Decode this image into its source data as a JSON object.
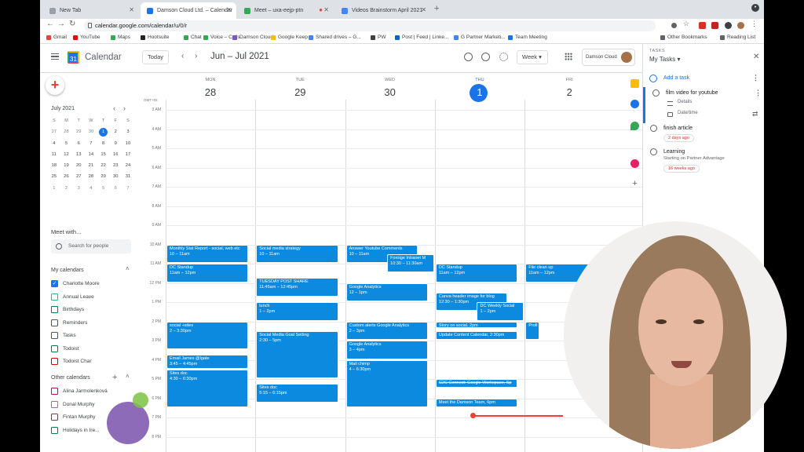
{
  "browser": {
    "tabs": [
      {
        "title": "New Tab",
        "fav": "#9aa0a6"
      },
      {
        "title": "Damson Cloud Ltd. – Calendar",
        "fav": "#1a73e8"
      },
      {
        "title": "Meet – uxa-eejp-ptn",
        "fav": "#34a853"
      },
      {
        "title": "Videos Brainstorm April 2021",
        "fav": "#4285f4"
      }
    ],
    "url": "calendar.google.com/calendar/u/0/r",
    "bookmarks": [
      "Gmail",
      "YouTube",
      "Maps",
      "Hootsuite",
      "Chat",
      "Voice – Calls",
      "Damson Cloud",
      "Google Keep",
      "Shared drives – G...",
      "PW",
      "Post | Feed | Linke...",
      "G Partner Marketi...",
      "Team Meeting"
    ],
    "bookmark_colors": [
      "#ea4335",
      "#ff0000",
      "#34a853",
      "#222222",
      "#34a853",
      "#34a853",
      "#7e57c2",
      "#fbbc04",
      "#4285f4",
      "#3c4043",
      "#0a66c2",
      "#4285f4",
      "#1a73e8"
    ],
    "other_bookmarks": "Other Bookmarks",
    "reading_list": "Reading List"
  },
  "header": {
    "app_name": "Calendar",
    "today_label": "Today",
    "date_range": "Jun – Jul 2021",
    "view": "Week",
    "account": "Damson Cloud"
  },
  "sidebar": {
    "create_icon": "plus-icon",
    "mini_title": "July 2021",
    "mini_days": [
      "S",
      "M",
      "T",
      "W",
      "T",
      "F",
      "S"
    ],
    "mini_weeks": [
      [
        "27",
        "28",
        "29",
        "30",
        "1",
        "2",
        "3"
      ],
      [
        "4",
        "5",
        "6",
        "7",
        "8",
        "9",
        "10"
      ],
      [
        "11",
        "12",
        "13",
        "14",
        "15",
        "16",
        "17"
      ],
      [
        "18",
        "19",
        "20",
        "21",
        "22",
        "23",
        "24"
      ],
      [
        "25",
        "26",
        "27",
        "28",
        "29",
        "30",
        "31"
      ],
      [
        "1",
        "2",
        "3",
        "4",
        "5",
        "6",
        "7"
      ]
    ],
    "meet_title": "Meet with...",
    "search_people": "Search for people",
    "my_calendars_title": "My calendars",
    "my_calendars": [
      {
        "name": "Charlotte Moore",
        "color": "#1a73e8",
        "checked": true
      },
      {
        "name": "Annual Leave",
        "color": "#33b679",
        "checked": false
      },
      {
        "name": "Birthdays",
        "color": "#0b8043",
        "checked": false
      },
      {
        "name": "Reminders",
        "color": "#3f51b5",
        "checked": false
      },
      {
        "name": "Tasks",
        "color": "#3f51b5",
        "checked": false
      },
      {
        "name": "Todoist",
        "color": "#0b8043",
        "checked": false
      },
      {
        "name": "Todoist Char",
        "color": "#d50000",
        "checked": false
      }
    ],
    "other_calendars_title": "Other calendars",
    "other_calendars": [
      {
        "name": "Alina Jarmolenková",
        "color": "#ad1457",
        "checked": false
      },
      {
        "name": "Donal Murphy",
        "color": "#9e69af",
        "checked": false
      },
      {
        "name": "Fintan Murphy",
        "color": "#8e24aa",
        "checked": false
      },
      {
        "name": "Holidays in Ire...",
        "color": "#0b8043",
        "checked": false
      }
    ]
  },
  "week": {
    "timezone": "GMT+02",
    "days": [
      {
        "dow": "MON",
        "num": "28"
      },
      {
        "dow": "TUE",
        "num": "29"
      },
      {
        "dow": "WED",
        "num": "30"
      },
      {
        "dow": "THU",
        "num": "1",
        "current": true
      },
      {
        "dow": "FRI",
        "num": "2"
      }
    ],
    "hours": [
      "3 AM",
      "4 AM",
      "5 AM",
      "6 AM",
      "7 AM",
      "8 AM",
      "9 AM",
      "10 AM",
      "11 AM",
      "12 PM",
      "1 PM",
      "2 PM",
      "3 PM",
      "4 PM",
      "5 PM",
      "6 PM",
      "7 PM",
      "8 PM"
    ],
    "events": [
      {
        "day": 0,
        "start": 10,
        "end": 11,
        "title": "Monthly Stat Report - social, web etc",
        "time": "10 – 11am"
      },
      {
        "day": 0,
        "start": 11,
        "end": 12,
        "title": "DC Standup",
        "time": "11am – 12pm"
      },
      {
        "day": 0,
        "start": 14,
        "end": 15.5,
        "title": "social +sites",
        "time": "2 – 3:30pm"
      },
      {
        "day": 0,
        "start": 15.75,
        "end": 16.5,
        "title": "Email James @lgate",
        "time": "3:45 – 4:45pm"
      },
      {
        "day": 0,
        "start": 16.5,
        "end": 18.5,
        "title": "Sites doc",
        "time": "4:30 – 6:30pm",
        "indent": true
      },
      {
        "day": 1,
        "start": 10,
        "end": 11,
        "title": "Social  media strategy",
        "time": "10 – 11am"
      },
      {
        "day": 1,
        "start": 11.75,
        "end": 12.75,
        "title": "TUESDAY POST SHARE",
        "time": "11:45am – 12:45pm"
      },
      {
        "day": 1,
        "start": 13,
        "end": 14,
        "title": "lunch",
        "time": "1 – 2pm"
      },
      {
        "day": 1,
        "start": 14.5,
        "end": 17,
        "title": "Social Media Goal Setting",
        "time": "2:30 – 5pm"
      },
      {
        "day": 1,
        "start": 17.25,
        "end": 18.25,
        "title": "Sites doc",
        "time": "5:15 – 6:15pm"
      },
      {
        "day": 2,
        "start": 10,
        "end": 11,
        "title": "Answer Youtube Comments",
        "time": "10 – 11am",
        "narrow": true
      },
      {
        "day": 2,
        "start": 10.5,
        "end": 11.5,
        "title": "Foroige Intranet M",
        "time": "10:30 – 11:30am",
        "shift": true
      },
      {
        "day": 2,
        "start": 12,
        "end": 13,
        "title": "Google Analytics",
        "time": "12 – 1pm"
      },
      {
        "day": 2,
        "start": 14,
        "end": 15,
        "title": "Custom alerts Google Analytics",
        "time": "2 – 3pm"
      },
      {
        "day": 2,
        "start": 15,
        "end": 16,
        "title": "Google Analytics",
        "time": "3 – 4pm"
      },
      {
        "day": 2,
        "start": 16,
        "end": 18.5,
        "title": "Mail chimp",
        "time": "4 – 6:30pm"
      },
      {
        "day": 3,
        "start": 11,
        "end": 12,
        "title": "DC Standup",
        "time": "11am – 12pm"
      },
      {
        "day": 3,
        "start": 12.5,
        "end": 13.5,
        "title": "Canva header image for blog",
        "time": "12:30 – 1:30pm",
        "narrow": true
      },
      {
        "day": 3,
        "start": 13,
        "end": 14,
        "title": "DC Weekly Social",
        "time": "1 – 2pm",
        "shift": true
      },
      {
        "day": 3,
        "start": 14,
        "end": 14.35,
        "title": "Story on social, 2pm",
        "time": "",
        "line": true
      },
      {
        "day": 3,
        "start": 14.5,
        "end": 15,
        "title": "Update Content Calendar, 2:30pm",
        "time": "",
        "line": true
      },
      {
        "day": 3,
        "start": 17,
        "end": 17.5,
        "title": "C2C Connect: Google Workspace, Sp",
        "time": "",
        "line": true,
        "strike": true
      },
      {
        "day": 3,
        "start": 18,
        "end": 18.5,
        "title": "Meet the Damson Team, 6pm",
        "time": "",
        "line": true
      },
      {
        "day": 4,
        "start": 11,
        "end": 12,
        "title": "File clean up",
        "time": "11am – 12pm",
        "narrow": true
      },
      {
        "day": 4,
        "start": 14,
        "end": 15,
        "title": "Profi",
        "time": "",
        "narrow2": true
      }
    ]
  },
  "tasks": {
    "label": "TASKS",
    "title": "My Tasks",
    "add_label": "Add a task",
    "editing": {
      "title": "film video for youtube",
      "details_placeholder": "Details",
      "date_label": "Date/time"
    },
    "items": [
      {
        "title": "finish article",
        "sub": "",
        "due": "2 days ago"
      },
      {
        "title": "Learning",
        "sub": "Starting on Partner Advantage",
        "due": "16 weeks ago"
      }
    ]
  }
}
